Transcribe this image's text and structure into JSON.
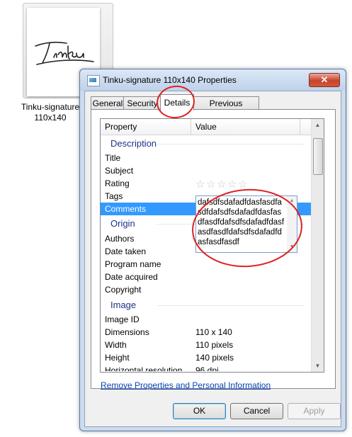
{
  "file": {
    "label_line1": "Tinku-signature",
    "label_line2": "110x140",
    "signature_text": "Tinku"
  },
  "dialog": {
    "title": "Tinku-signature 110x140 Properties",
    "close_glyph": "✕",
    "tabs": [
      "General",
      "Security",
      "Details",
      "Previous Versions"
    ],
    "active_tab": "Details",
    "columns": {
      "property": "Property",
      "value": "Value"
    },
    "groups": {
      "description": "Description",
      "origin": "Origin",
      "image": "Image"
    },
    "rows": {
      "title": "Title",
      "subject": "Subject",
      "rating": "Rating",
      "tags": "Tags",
      "comments": "Comments",
      "authors": "Authors",
      "date_taken": "Date taken",
      "program_name": "Program name",
      "date_acquired": "Date acquired",
      "copyright": "Copyright",
      "image_id": "Image ID",
      "dimensions": "Dimensions",
      "dimensions_value": "110 x 140",
      "width": "Width",
      "width_value": "110 pixels",
      "height": "Height",
      "height_value": "140 pixels",
      "horizontal_resolution": "Horizontal resolution",
      "horizontal_resolution_value": "96 dpi"
    },
    "rating_stars": 0,
    "comments_value": "dafsdfsdafadfdasfasdfasdfdafsdfsdafadfdasfasdfasdfdafsdfsdafadfdasfasdfasdfdafsdfsdafadfdasfasdfasdf",
    "remove_link": "Remove Properties and Personal Information",
    "buttons": {
      "ok": "OK",
      "cancel": "Cancel",
      "apply": "Apply"
    },
    "annotation_color": "#e02020"
  }
}
